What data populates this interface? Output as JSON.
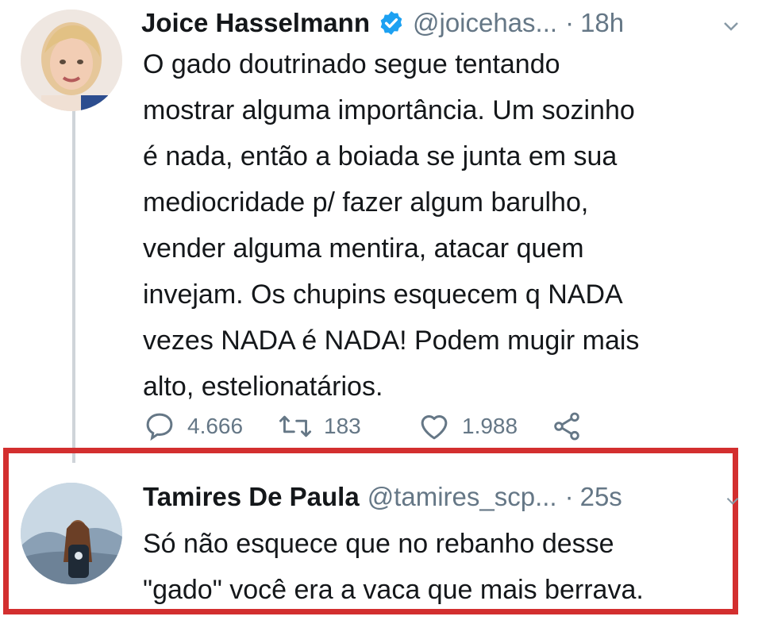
{
  "tweet": {
    "author_name": "Joice Hasselmann",
    "handle": "@joicehas...",
    "separator": "·",
    "time": "18h",
    "lines": [
      "O gado doutrinado segue tentando",
      "mostrar alguma importância. Um sozinho",
      "é nada, então a boiada se junta em sua",
      "mediocridade p/ fazer algum barulho,",
      "vender alguma mentira, atacar quem",
      "invejam. Os chupins esquecem q NADA",
      "vezes NADA é NADA! Podem mugir mais",
      "alto, estelionatários."
    ],
    "reply_count": "4.666",
    "retweet_count": "183",
    "like_count": "1.988"
  },
  "reply": {
    "author_name": "Tamires De Paula",
    "handle": "@tamires_scp...",
    "separator": "·",
    "time": "25s",
    "lines": [
      "Só não esquece que no rebanho desse",
      "\"gado\" você era a vaca que mais berrava."
    ]
  },
  "icons": {
    "verified": "verified-badge-icon",
    "caret": "chevron-down-icon",
    "reply": "comment-icon",
    "retweet": "retweet-icon",
    "like": "heart-icon",
    "share": "share-icon"
  },
  "colors": {
    "verified": "#1da1f2",
    "highlight_border": "#d32f2f",
    "secondary_text": "#657786"
  }
}
